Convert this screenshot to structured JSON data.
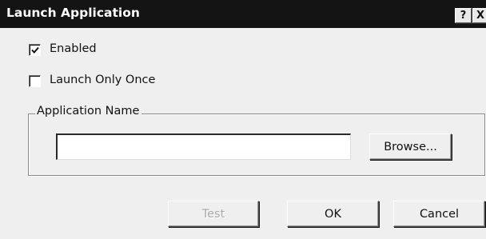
{
  "window": {
    "title": "Launch Application",
    "help_glyph": "?",
    "close_glyph": "X"
  },
  "options": {
    "enabled": {
      "label": "Enabled",
      "checked": true
    },
    "launch_once": {
      "label": "Launch Only Once",
      "checked": false
    }
  },
  "app_group": {
    "legend": "Application Name",
    "input_value": "",
    "browse_label": "Browse..."
  },
  "footer": {
    "test_label": "Test",
    "test_enabled": false,
    "ok_label": "OK",
    "cancel_label": "Cancel"
  },
  "colors": {
    "titlebar": "#141414",
    "dialog_bg": "#efefef",
    "disabled_text": "#a9a9a9"
  }
}
